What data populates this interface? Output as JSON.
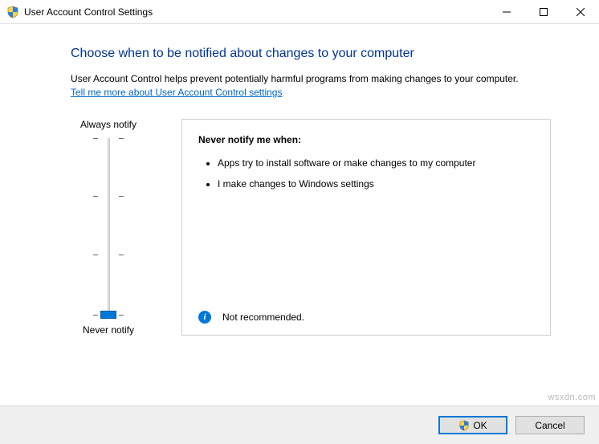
{
  "window": {
    "title": "User Account Control Settings"
  },
  "page": {
    "heading": "Choose when to be notified about changes to your computer",
    "description": "User Account Control helps prevent potentially harmful programs from making changes to your computer.",
    "link": "Tell me more about User Account Control settings"
  },
  "slider": {
    "top_label": "Always notify",
    "bottom_label": "Never notify"
  },
  "info": {
    "title": "Never notify me when:",
    "bullets": [
      "Apps try to install software or make changes to my computer",
      "I make changes to Windows settings"
    ],
    "status": "Not recommended."
  },
  "buttons": {
    "ok": "OK",
    "cancel": "Cancel"
  },
  "watermark": "wsxdn.com"
}
